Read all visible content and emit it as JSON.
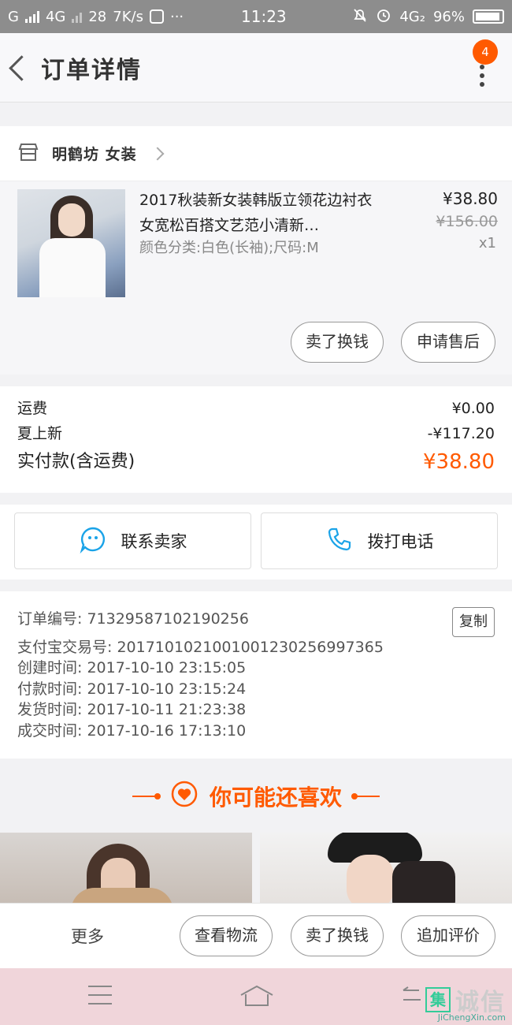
{
  "status_bar": {
    "carrier1": "G",
    "carrier2": "4G",
    "net_count": "28",
    "speed": "7K/s",
    "more": "···",
    "time": "11:23",
    "net_type": "4G₂",
    "battery": "96%"
  },
  "header": {
    "title": "订单详情",
    "badge_count": "4"
  },
  "shop": {
    "name": "明鹤坊 女装"
  },
  "product": {
    "name": "2017秋装新女装韩版立领花边衬衣女宽松百搭文艺范小清新…",
    "spec": "颜色分类:白色(长袖);尺码:M",
    "price": "¥38.80",
    "original_price": "¥156.00",
    "quantity": "x1",
    "sell_button": "卖了换钱",
    "aftersale_button": "申请售后"
  },
  "fees": {
    "shipping_label": "运费",
    "shipping_value": "¥0.00",
    "discount_label": "夏上新",
    "discount_value": "-¥117.20",
    "total_label": "实付款(含运费)",
    "total_value": "¥38.80"
  },
  "contact": {
    "seller": "联系卖家",
    "phone": "拨打电话"
  },
  "order_info": {
    "order_no": "订单编号: 71329587102190256",
    "copy": "复制",
    "alipay_no": "支付宝交易号: 2017101021001001230256997365",
    "created": "创建时间: 2017-10-10 23:15:05",
    "paid": "付款时间: 2017-10-10 23:15:24",
    "shipped": "发货时间: 2017-10-11 21:23:38",
    "completed": "成交时间: 2017-10-16 17:13:10"
  },
  "recommend": {
    "title": "你可能还喜欢"
  },
  "bottom_bar": {
    "more": "更多",
    "logistics": "查看物流",
    "sell": "卖了换钱",
    "review": "追加评价"
  },
  "watermark": {
    "text": "诚信",
    "box": "集",
    "url": "JiChengXin.com"
  },
  "colors": {
    "accent": "#ff5a00",
    "contact_blue": "#1aa3e8"
  }
}
